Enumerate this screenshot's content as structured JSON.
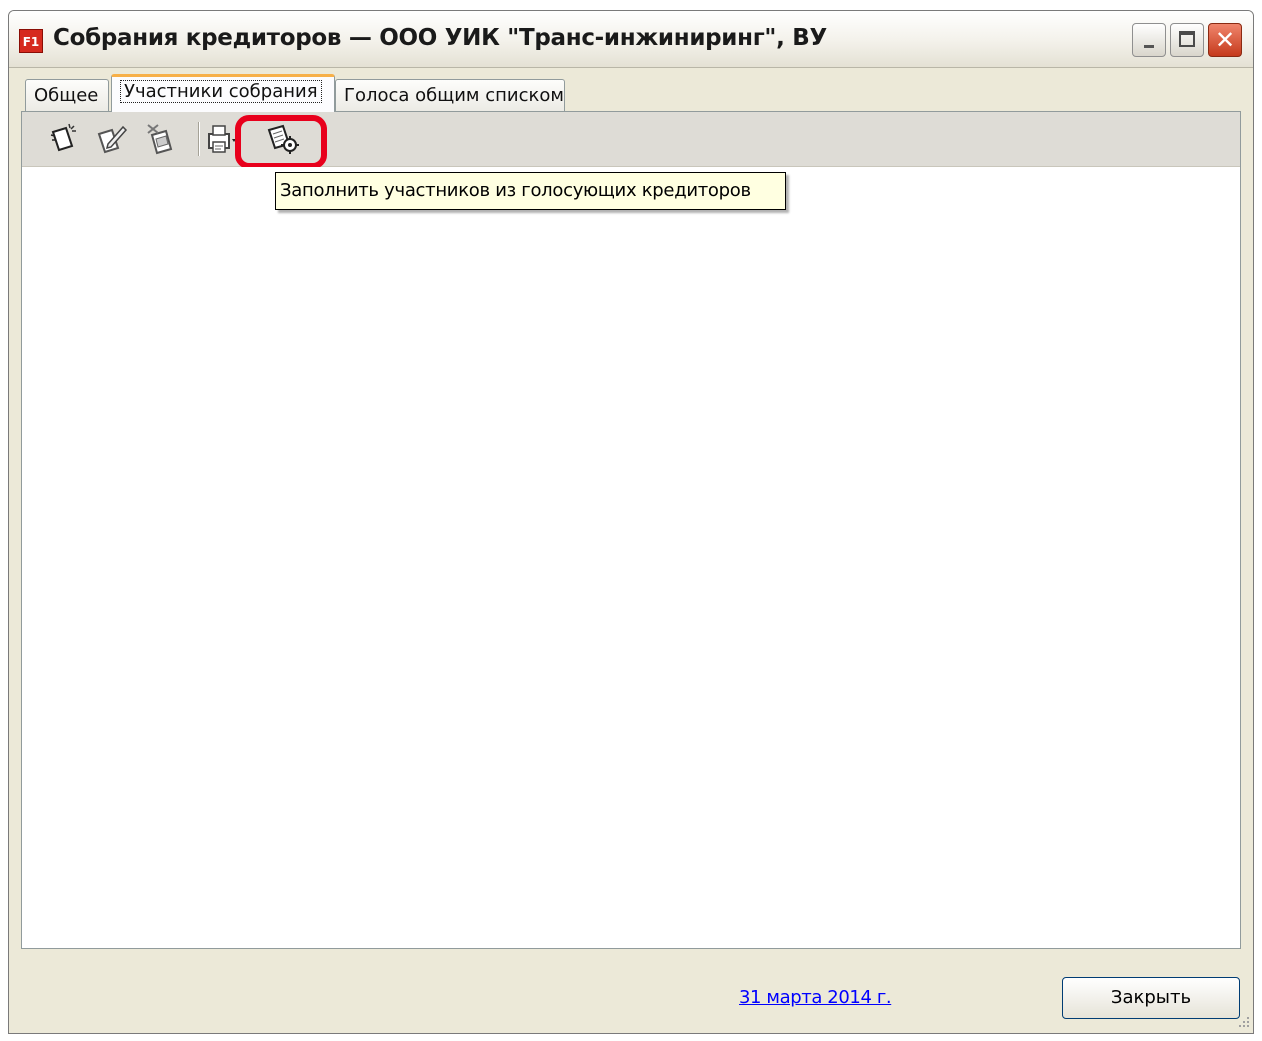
{
  "window": {
    "app_icon_text": "F1",
    "title": "Собрания кредиторов — ООО УИК \"Транс-инжиниринг\", ВУ",
    "controls": {
      "minimize": "minimize-icon",
      "maximize": "maximize-icon",
      "close": "close-icon"
    }
  },
  "tabs": [
    {
      "label": "Общее",
      "active": false
    },
    {
      "label": "Участники собрания",
      "active": true
    },
    {
      "label": "Голоса общим списком",
      "active": false
    }
  ],
  "toolbar": {
    "buttons": [
      {
        "icon": "new-document-icon"
      },
      {
        "icon": "edit-document-icon"
      },
      {
        "icon": "delete-document-icon"
      },
      {
        "icon": "print-icon",
        "has_dropdown": true
      },
      {
        "icon": "fill-participants-icon",
        "highlighted": true
      }
    ]
  },
  "tooltip": {
    "text": "Заполнить участников из голосующих кредиторов"
  },
  "footer": {
    "date_link": "31 марта 2014 г.",
    "close_button": "Закрыть"
  },
  "colors": {
    "highlight": "#e8001c",
    "tooltip_bg": "#ffffe1",
    "link": "#0000ff",
    "active_tab_accent": "#f7b048"
  }
}
